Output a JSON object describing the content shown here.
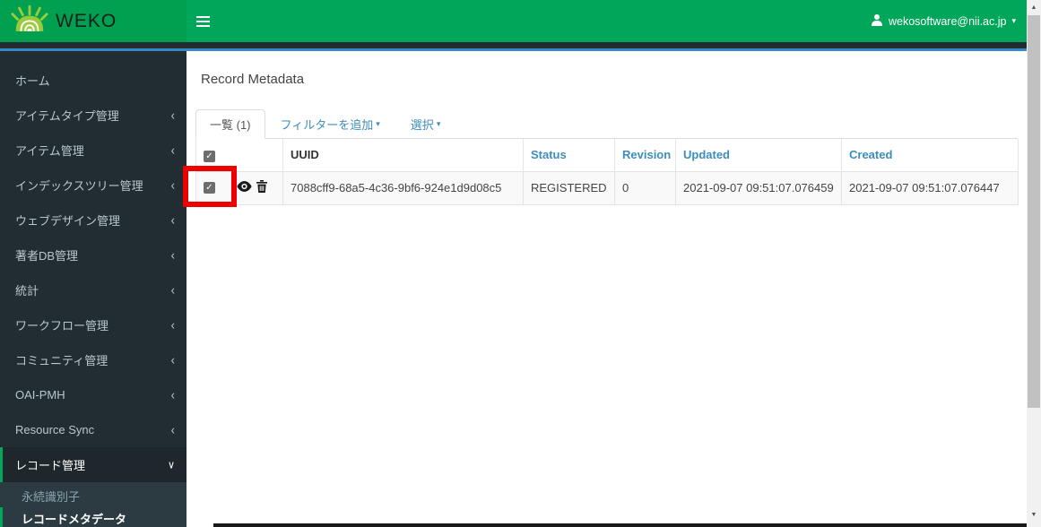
{
  "header": {
    "brand": "WEKO",
    "user_email": "wekosoftware@nii.ac.jp"
  },
  "icons": {
    "caret_down": "▾",
    "check": "✓",
    "scroll_up": "▲",
    "scroll_down": "▼"
  },
  "colors": {
    "navbar_green": "#00a65a",
    "accent_blue": "#3589c9",
    "link_blue": "#3c8dbc",
    "sidebar_dark": "#222d32",
    "submenu_dark": "#2c3b41",
    "annotation_red": "#ee0000"
  },
  "sidebar": {
    "items": [
      {
        "label": "ホーム",
        "chevron": ""
      },
      {
        "label": "アイテムタイプ管理",
        "chevron": "‹"
      },
      {
        "label": "アイテム管理",
        "chevron": "‹"
      },
      {
        "label": "インデックスツリー管理",
        "chevron": "‹"
      },
      {
        "label": "ウェブデザイン管理",
        "chevron": "‹"
      },
      {
        "label": "著者DB管理",
        "chevron": "‹"
      },
      {
        "label": "統計",
        "chevron": "‹"
      },
      {
        "label": "ワークフロー管理",
        "chevron": "‹"
      },
      {
        "label": "コミュニティ管理",
        "chevron": "‹"
      },
      {
        "label": "OAI-PMH",
        "chevron": "‹"
      },
      {
        "label": "Resource Sync",
        "chevron": "‹"
      },
      {
        "label": "レコード管理",
        "chevron": "∨"
      }
    ],
    "submenu": [
      {
        "label": "永続識別子"
      },
      {
        "label": "レコードメタデータ"
      }
    ]
  },
  "main": {
    "title": "Record Metadata",
    "tabs": {
      "list": "一覧 (1)",
      "filter": "フィルターを追加",
      "select": "選択"
    },
    "table": {
      "headers": [
        "UUID",
        "Status",
        "Revision",
        "Updated",
        "Created"
      ],
      "rows": [
        {
          "uuid": "7088cff9-68a5-4c36-9bf6-924e1d9d08c5",
          "status": "REGISTERED",
          "revision": "0",
          "updated": "2021-09-07 09:51:07.076459",
          "created": "2021-09-07 09:51:07.076447"
        }
      ]
    }
  }
}
